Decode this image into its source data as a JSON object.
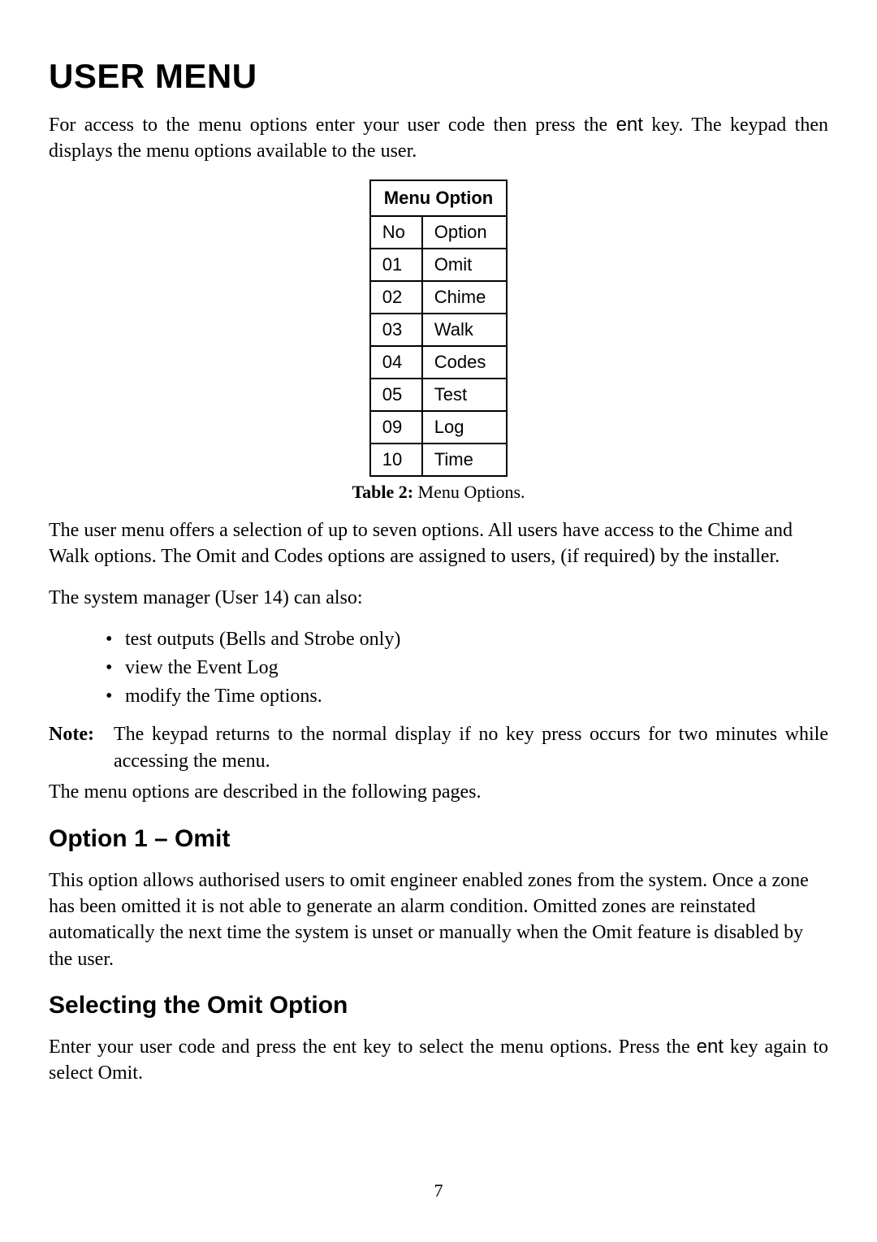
{
  "page": {
    "title": "USER MENU",
    "intro_before_ent": "For access to the menu options enter your user code then press the ",
    "intro_ent": "ent",
    "intro_after_ent": " key. The keypad then displays the menu options available to the user.",
    "table_header": "Menu Option",
    "table_subhead_no": "No",
    "table_subhead_option": "Option",
    "menu_options": [
      {
        "no": "01",
        "option": "Omit"
      },
      {
        "no": "02",
        "option": "Chime"
      },
      {
        "no": "03",
        "option": "Walk"
      },
      {
        "no": "04",
        "option": "Codes"
      },
      {
        "no": "05",
        "option": "Test"
      },
      {
        "no": "09",
        "option": "Log"
      },
      {
        "no": "10",
        "option": "Time"
      }
    ],
    "table_caption_label": "Table 2:",
    "table_caption_text": " Menu Options.",
    "para_after_table": "The user menu offers a selection of up to seven options. All users have access to the Chime and Walk options. The Omit and Codes options are assigned to users, (if required) by the installer.",
    "para_manager": "The system manager (User 14) can also:",
    "bullets": [
      "test outputs (Bells and Strobe only)",
      "view the Event Log",
      "modify the Time options."
    ],
    "note_label": "Note:",
    "note_body": "The keypad returns to the normal display if no key press occurs for two minutes while accessing the menu.",
    "para_following": "The menu options are described in the following pages.",
    "h2_omit": "Option 1 – Omit",
    "para_omit": "This option allows authorised users to omit engineer enabled zones from the system. Once a zone has been omitted it is not able to generate an alarm condition. Omitted zones are reinstated automatically the next time the system is unset or manually when the Omit feature is disabled by the user.",
    "h2_selecting": "Selecting the Omit Option",
    "para_selecting_before": "Enter your user code and press the ent key to select the menu options. Press the ",
    "para_selecting_ent": "ent",
    "para_selecting_after": " key again to select Omit.",
    "page_number": "7"
  }
}
